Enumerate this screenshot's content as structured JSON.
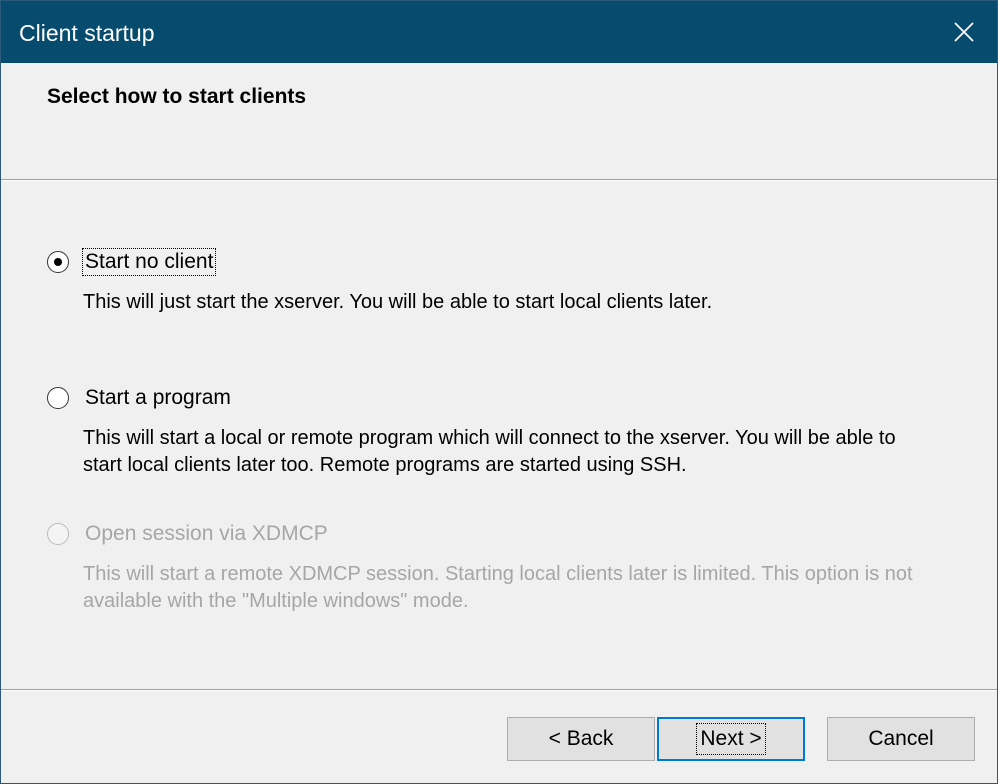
{
  "window": {
    "title": "Client startup",
    "close_icon": "close-icon"
  },
  "header": {
    "title": "Select how to start clients"
  },
  "options": [
    {
      "label": "Start no client",
      "description": "This will just start the xserver. You will be able to start local clients later.",
      "checked": true,
      "enabled": true
    },
    {
      "label": "Start a program",
      "description": "This will start a local or remote program which will connect to the xserver. You will be able to start local clients later too. Remote programs are started using SSH.",
      "checked": false,
      "enabled": true
    },
    {
      "label": "Open session via XDMCP",
      "description": "This will start a remote XDMCP session. Starting local clients later is limited. This option is not available with the \"Multiple windows\" mode.",
      "checked": false,
      "enabled": false
    }
  ],
  "buttons": {
    "back": "< Back",
    "next": "Next >",
    "cancel": "Cancel"
  },
  "colors": {
    "titlebar": "#074c6e",
    "disabled_text": "#a6a6a6",
    "default_button_border": "#0078d7"
  }
}
